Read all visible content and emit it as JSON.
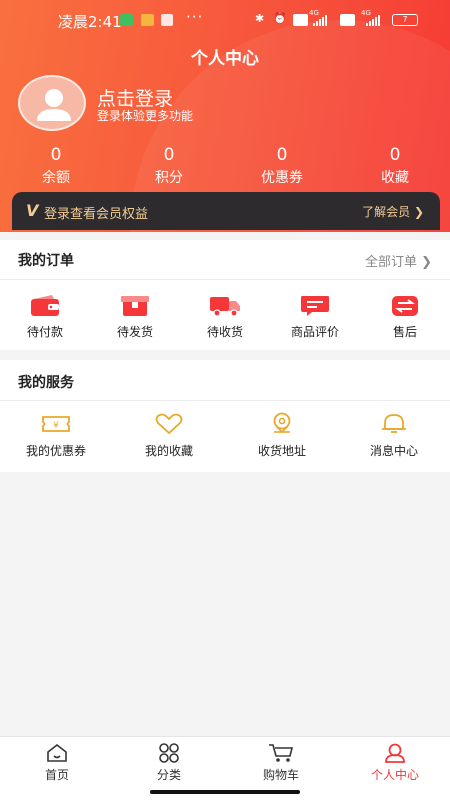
{
  "status_bar": {
    "time": "凌晨2:41",
    "dots": "···",
    "net1": "4G",
    "net2": "4G",
    "battery": "7"
  },
  "header": {
    "title": "个人中心"
  },
  "profile": {
    "login_title": "点击登录",
    "login_subtitle": "登录体验更多功能"
  },
  "stats": [
    {
      "value": "0",
      "label": "余额"
    },
    {
      "value": "0",
      "label": "积分"
    },
    {
      "value": "0",
      "label": "优惠券"
    },
    {
      "value": "0",
      "label": "收藏"
    }
  ],
  "vip": {
    "badge": "V",
    "text": "登录查看会员权益",
    "link": "了解会员 ❯"
  },
  "orders": {
    "title": "我的订单",
    "all_link": "全部订单 ❯",
    "items": [
      {
        "label": "待付款",
        "icon": "wallet-icon"
      },
      {
        "label": "待发货",
        "icon": "package-icon"
      },
      {
        "label": "待收货",
        "icon": "truck-icon"
      },
      {
        "label": "商品评价",
        "icon": "comment-icon"
      },
      {
        "label": "售后",
        "icon": "exchange-icon"
      }
    ]
  },
  "services": {
    "title": "我的服务",
    "items": [
      {
        "label": "我的优惠券",
        "icon": "coupon-icon"
      },
      {
        "label": "我的收藏",
        "icon": "heart-icon"
      },
      {
        "label": "收货地址",
        "icon": "location-icon"
      },
      {
        "label": "消息中心",
        "icon": "bell-icon"
      }
    ]
  },
  "tabbar": [
    {
      "label": "首页",
      "icon": "home-icon"
    },
    {
      "label": "分类",
      "icon": "grid-icon"
    },
    {
      "label": "购物车",
      "icon": "cart-icon"
    },
    {
      "label": "个人中心",
      "icon": "user-icon",
      "active": true
    }
  ],
  "colors": {
    "brand": "#f5373a",
    "gold": "#e9a82a",
    "vip_text": "#f2cc94"
  }
}
